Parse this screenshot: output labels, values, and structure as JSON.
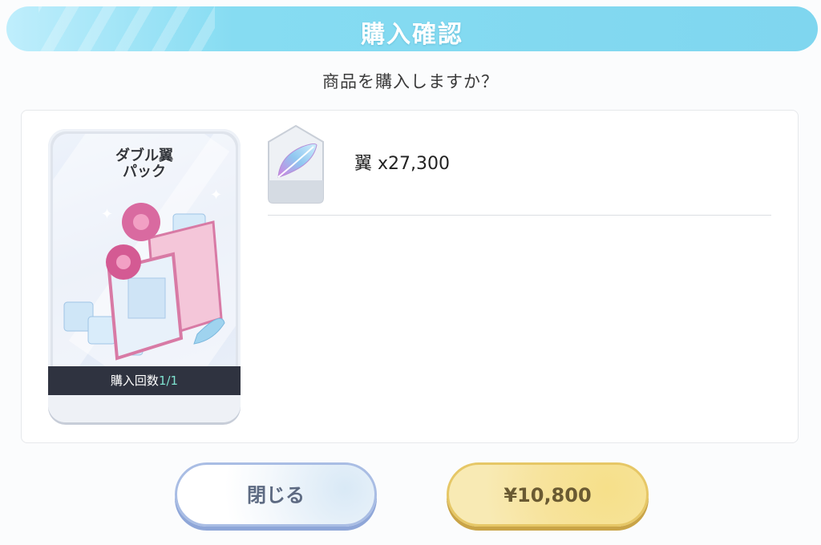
{
  "dialog": {
    "title": "購入確認",
    "question": "商品を購入しますか？"
  },
  "pack": {
    "name": "ダブル翼\nパック",
    "count_label": "購入回数",
    "count_value": "1/1"
  },
  "item": {
    "icon": "wing-feather-icon",
    "label": "翼 x27,300"
  },
  "buttons": {
    "close_label": "閉じる",
    "buy_label": "¥10,800"
  },
  "colors": {
    "title_bar": "#86dcf2",
    "buy_button": "#f6e08a",
    "close_border": "#a9bde4",
    "count_highlight": "#7fe3d0"
  }
}
